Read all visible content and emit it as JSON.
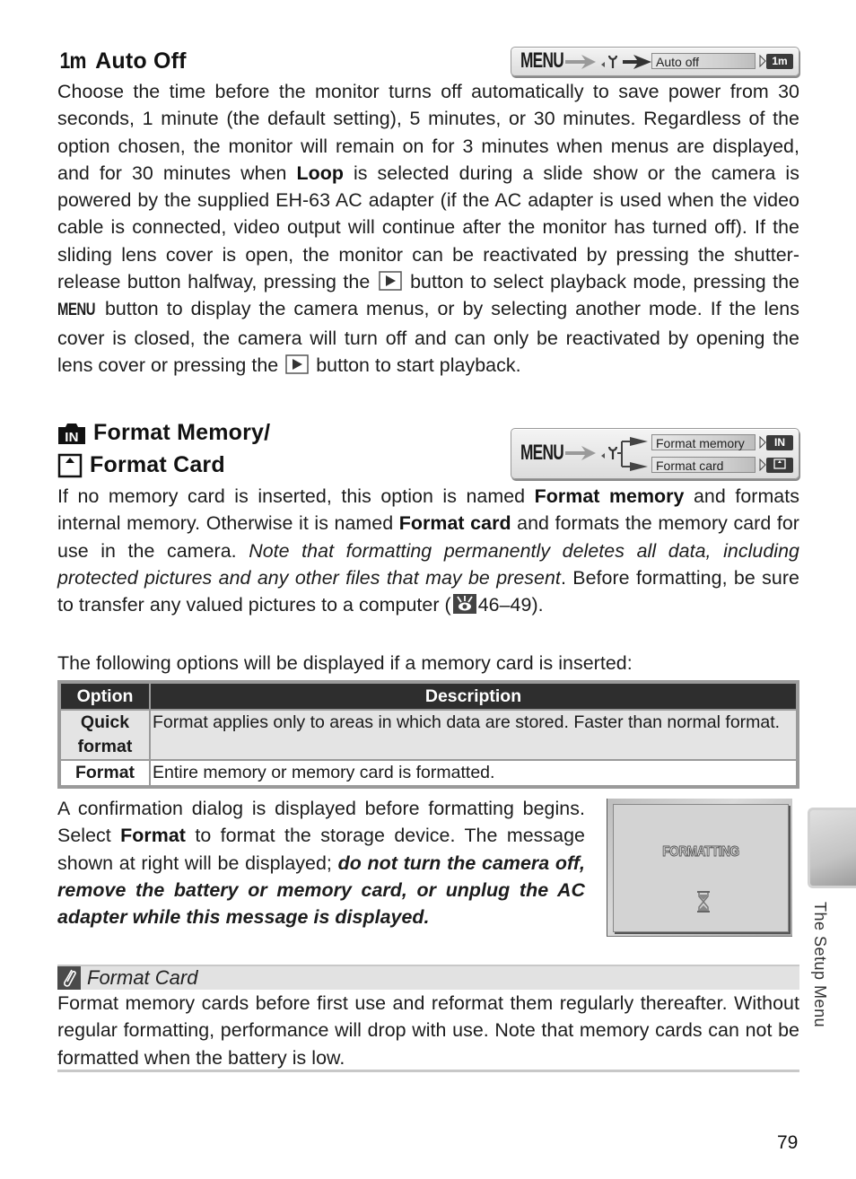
{
  "auto_off": {
    "icon_label": "1m",
    "title": "Auto Off",
    "menu_path": {
      "menu_label": "MENU",
      "item": "Auto off",
      "badge": "1m"
    },
    "para1_a": "Choose the time before the monitor turns off automatically to save power from 30 seconds, 1 minute (the default setting), 5 minutes, or 30 minutes. Regardless of the option chosen, the monitor will remain on for 3 minutes when menus are displayed, and for 30 minutes when ",
    "para1_bold": "Loop",
    "para1_b": " is selected during a slide show or the camera is powered by the supplied EH-63 AC adapter (if the AC adapter is used when the video cable is connected, video output will continue after the monitor has turned off).  If the sliding lens cover is open, the monitor can be reactivated by pressing the shutter-release button halfway, pressing the ",
    "para1_c": " button to select playback mode, pressing the ",
    "para1_menu": "MENU",
    "para1_d": " button to display the camera menus, or by selecting another mode.  If the lens cover is closed, the camera will turn off and can only be reactivated by opening the lens cover or pressing the ",
    "para1_e": " button to start playback."
  },
  "format": {
    "title_line1": "Format Memory/",
    "title_line2": "Format Card",
    "icon_internal": "IN",
    "menu_path": {
      "menu_label": "MENU",
      "items": [
        {
          "label": "Format memory",
          "badge": "IN"
        },
        {
          "label": "Format card",
          "badge": ""
        }
      ]
    },
    "para1_a": "If no memory card is inserted, this option is named ",
    "para1_bold1": "Format memory",
    "para1_b": " and formats internal memory.  Otherwise it is named ",
    "para1_bold2": "Format card",
    "para1_c": " and formats the memory card for use in the camera.  ",
    "para1_italic": "Note that formatting permanently deletes all data, including protected pictures and any other files that may be present",
    "para1_d": ".  Before formatting, be sure to transfer any valued pictures to a computer (",
    "para1_ref": "46–49",
    "para1_e": ").",
    "para2": "The following options will be displayed if a memory card is inserted:",
    "table": {
      "headers": [
        "Option",
        "Description"
      ],
      "rows": [
        {
          "option": "Quick format",
          "description": "Format applies only to areas in which data are stored.  Faster than normal format."
        },
        {
          "option": "Format",
          "description": "Entire memory or memory card is formatted."
        }
      ]
    },
    "para3_a": "A confirmation dialog is displayed before formatting begins.  Select ",
    "para3_bold": "Format",
    "para3_b": " to format the storage device. The message shown at right will be displayed; ",
    "para3_bolditalic": "do not turn the camera off, remove the battery or memory card, or unplug the AC adapter while this message is displayed.",
    "screen_text": "FORMATTING"
  },
  "note": {
    "title": "Format Card",
    "body": "Format memory cards before first use and reformat them regularly thereafter.  Without regular formatting, performance will drop with use.  Note that memory cards can not be formatted when the battery is low."
  },
  "side_tab_label": "The Setup Menu",
  "page_number": "79"
}
